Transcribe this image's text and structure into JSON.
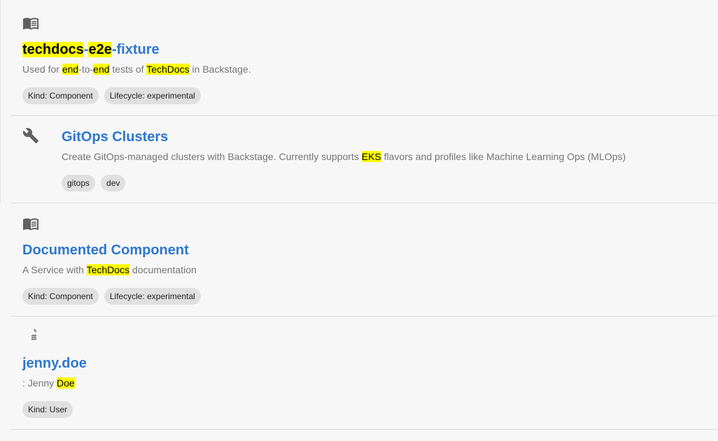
{
  "results": [
    {
      "icon": "book-icon",
      "title_parts": [
        {
          "text": "techdocs",
          "hl": true
        },
        {
          "text": "-",
          "hl": false
        },
        {
          "text": "e2e",
          "hl": true
        },
        {
          "text": "-fixture",
          "hl": false
        }
      ],
      "desc_parts": [
        {
          "text": "Used for ",
          "hl": false
        },
        {
          "text": "end",
          "hl": true
        },
        {
          "text": "-to-",
          "hl": false
        },
        {
          "text": "end",
          "hl": true
        },
        {
          "text": " tests of ",
          "hl": false
        },
        {
          "text": "TechDocs",
          "hl": true
        },
        {
          "text": " in Backstage.",
          "hl": false
        }
      ],
      "chips": [
        "Kind: Component",
        "Lifecycle: experimental"
      ]
    },
    {
      "icon": "wrench-icon",
      "title_parts": [
        {
          "text": "GitOps Clusters",
          "hl": false
        }
      ],
      "desc_parts": [
        {
          "text": "Create GitOps-managed clusters with Backstage. Currently supports ",
          "hl": false
        },
        {
          "text": "EKS",
          "hl": true
        },
        {
          "text": " flavors and profiles like Machine Learning Ops (MLOps)",
          "hl": false
        }
      ],
      "chips": [
        "gitops",
        "dev"
      ]
    },
    {
      "icon": "book-icon",
      "title_parts": [
        {
          "text": "Documented Component",
          "hl": false
        }
      ],
      "desc_parts": [
        {
          "text": "A Service with ",
          "hl": false
        },
        {
          "text": "TechDocs",
          "hl": true
        },
        {
          "text": " documentation",
          "hl": false
        }
      ],
      "chips": [
        "Kind: Component",
        "Lifecycle: experimental"
      ]
    },
    {
      "icon": "book-icon",
      "title_parts": [
        {
          "text": "jenny.doe",
          "hl": false
        }
      ],
      "desc_parts": [
        {
          "text": ": Jenny ",
          "hl": false
        },
        {
          "text": "Doe",
          "hl": true
        }
      ],
      "chips": [
        "Kind: User"
      ]
    }
  ]
}
